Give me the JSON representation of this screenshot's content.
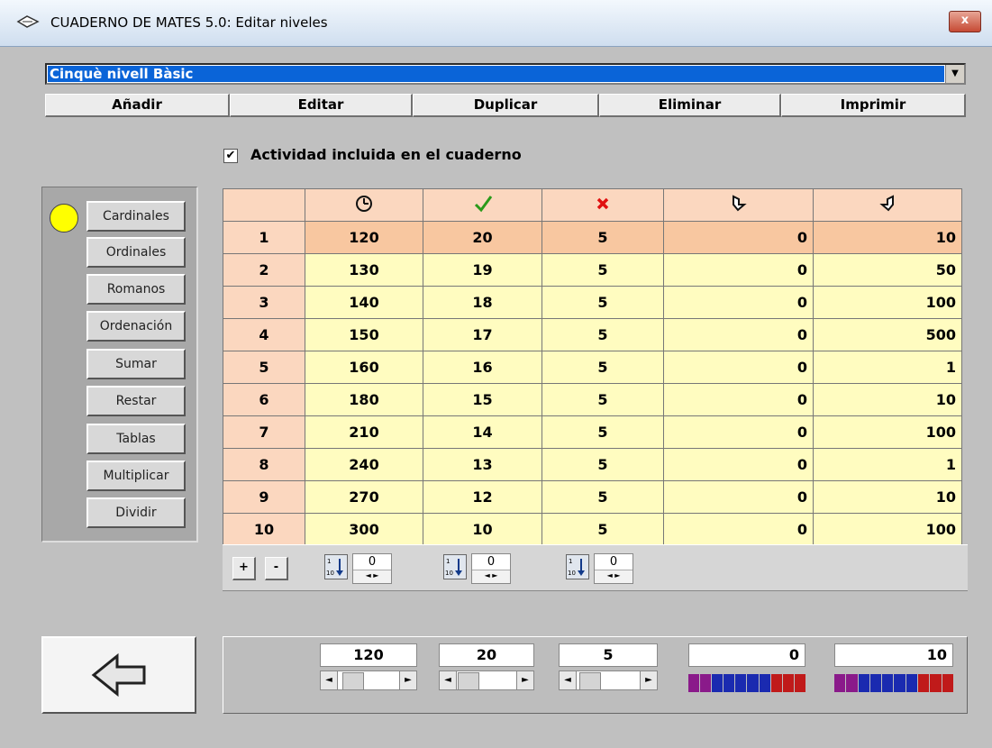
{
  "window": {
    "title": "CUADERNO DE MATES 5.0: Editar niveles",
    "close_label": "x"
  },
  "level_select": {
    "value": "Cinquè nivell Bàsic"
  },
  "toolbar": {
    "buttons": [
      "Añadir",
      "Editar",
      "Duplicar",
      "Eliminar",
      "Imprimir"
    ]
  },
  "activity_checkbox": {
    "checked": true,
    "label": "Actividad incluida en el cuaderno"
  },
  "categories": [
    "Cardinales",
    "Ordinales",
    "Romanos",
    "Ordenación",
    "Sumar",
    "Restar",
    "Tablas",
    "Multiplicar",
    "Dividir"
  ],
  "table": {
    "header_icons": [
      "clock-icon",
      "check-icon",
      "cross-icon",
      "hand-down-icon",
      "hand-up-icon"
    ],
    "rows": [
      [
        "1",
        "120",
        "20",
        "5",
        "0",
        "10"
      ],
      [
        "2",
        "130",
        "19",
        "5",
        "0",
        "50"
      ],
      [
        "3",
        "140",
        "18",
        "5",
        "0",
        "100"
      ],
      [
        "4",
        "150",
        "17",
        "5",
        "0",
        "500"
      ],
      [
        "5",
        "160",
        "16",
        "5",
        "0",
        "1"
      ],
      [
        "6",
        "180",
        "15",
        "5",
        "0",
        "10"
      ],
      [
        "7",
        "210",
        "14",
        "5",
        "0",
        "100"
      ],
      [
        "8",
        "240",
        "13",
        "5",
        "0",
        "1"
      ],
      [
        "9",
        "270",
        "12",
        "5",
        "0",
        "10"
      ],
      [
        "10",
        "300",
        "10",
        "5",
        "0",
        "100"
      ]
    ]
  },
  "row_buttons": {
    "add": "+",
    "remove": "-"
  },
  "spinners": [
    "0",
    "0",
    "0"
  ],
  "bottom_values": {
    "time": "120",
    "correct": "20",
    "errors": "5",
    "hand_down": "0",
    "hand_up": "10"
  },
  "colors": {
    "highlight": "#0a64d8",
    "header": "#fbd7bf",
    "cell": "#fffcc0",
    "indicator": "#ffff00"
  }
}
